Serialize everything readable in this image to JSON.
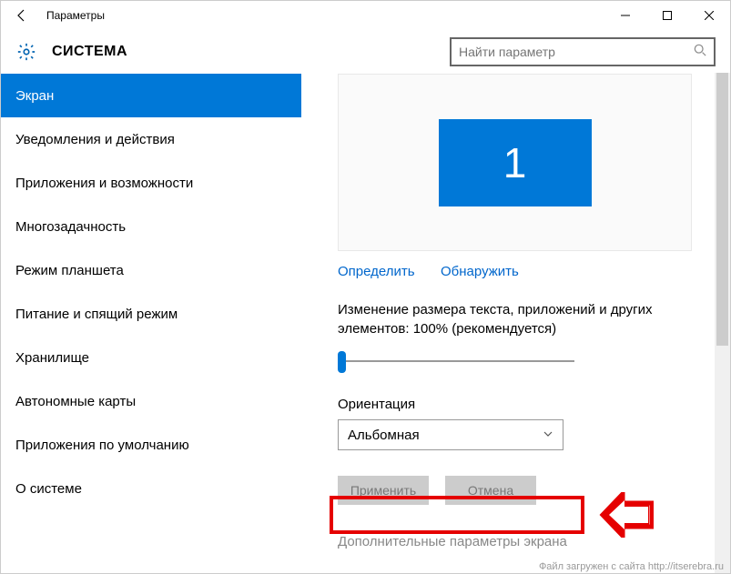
{
  "titlebar": {
    "title": "Параметры"
  },
  "header": {
    "app_title": "СИСТЕМА",
    "search_placeholder": "Найти параметр"
  },
  "sidebar": {
    "items": [
      {
        "label": "Экран",
        "active": true
      },
      {
        "label": "Уведомления и действия"
      },
      {
        "label": "Приложения и возможности"
      },
      {
        "label": "Многозадачность"
      },
      {
        "label": "Режим планшета"
      },
      {
        "label": "Питание и спящий режим"
      },
      {
        "label": "Хранилище"
      },
      {
        "label": "Автономные карты"
      },
      {
        "label": "Приложения по умолчанию"
      },
      {
        "label": "О системе"
      }
    ]
  },
  "content": {
    "monitor_number": "1",
    "identify": "Определить",
    "detect": "Обнаружить",
    "scale_text": "Изменение размера текста, приложений и других элементов: 100% (рекомендуется)",
    "orientation_label": "Ориентация",
    "orientation_value": "Альбомная",
    "apply": "Применить",
    "cancel": "Отмена",
    "advanced": "Дополнительные параметры экрана"
  },
  "footer": "Файл загружен с сайта http://itserebra.ru"
}
